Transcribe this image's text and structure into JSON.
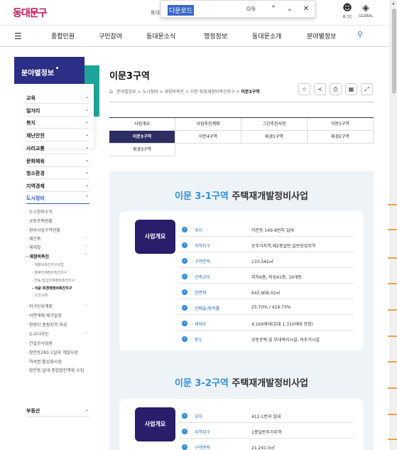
{
  "header": {
    "logo": "동대문구",
    "search_hint": "동대",
    "utils": [
      {
        "icon": "person-icon",
        "glyph": "👤",
        "label": "로그인"
      },
      {
        "icon": "globe-icon",
        "glyph": "🌐",
        "label": "GLOBAL"
      }
    ]
  },
  "find": {
    "query": "다운로드",
    "count": "0/6"
  },
  "gnb": [
    "종합민원",
    "구민참여",
    "동대문소식",
    "행정정보",
    "동대문소개",
    "분야별정보"
  ],
  "lnb": {
    "title": "분야별정보",
    "items": [
      {
        "label": "교육"
      },
      {
        "label": "일자리"
      },
      {
        "label": "복지"
      },
      {
        "label": "재난안전"
      },
      {
        "label": "사리교통"
      },
      {
        "label": "문화체육"
      },
      {
        "label": "청소환경"
      },
      {
        "label": "지역경제"
      },
      {
        "label": "도시정비"
      }
    ],
    "sub": [
      {
        "label": "· 도시정비소식"
      },
      {
        "label": "· 공동주택현황"
      },
      {
        "label": "· 정비사업구역현황"
      },
      {
        "label": "· 재건축"
      },
      {
        "label": "· 재개발"
      },
      {
        "label": "· 재정비촉진"
      }
    ],
    "sub3": [
      "- 재정비촉진지구사업",
      "- 청량리재정비촉진지구",
      "- 전농·답십리재정비촉진지구",
      "- 이문·휘경재정비촉진지구",
      "- 의국사례"
    ],
    "sub_after": [
      {
        "label": "· 지구단위계획"
      },
      {
        "label": "· 석면해체·제거알정"
      },
      {
        "label": "· 청량리 종점지역 육성"
      },
      {
        "label": "· 도시디자인"
      },
      {
        "label": "· 건설공사업원"
      },
      {
        "label": "· 장안동283-1일대 개발사업"
      },
      {
        "label": "· 역세권 활성화사업"
      },
      {
        "label": "· 장안동 일대 종합발전계획 수립"
      }
    ],
    "last": "부동산"
  },
  "page": {
    "title": "이문3구역",
    "breadcrumb": [
      "분야별정보",
      "도시정비",
      "재정비촉진",
      "이문·휘경재정비촉진지구"
    ],
    "breadcrumb_current": "이문3구역",
    "tools": [
      {
        "icon": "star-icon",
        "glyph": "☆"
      },
      {
        "icon": "share-icon",
        "glyph": "⋖"
      },
      {
        "icon": "print-icon",
        "glyph": "⎙"
      },
      {
        "icon": "qr-icon",
        "glyph": "▦"
      },
      {
        "icon": "expand-icon",
        "glyph": "⤢"
      }
    ]
  },
  "tabs": [
    {
      "label": "사업개요"
    },
    {
      "label": "사업추진계획"
    },
    {
      "label": "그간추진사항"
    },
    {
      "label": "이문1구역"
    },
    {
      "label": "이문3구역",
      "selected": true
    },
    {
      "label": "이문4구역"
    },
    {
      "label": "휘경1구역"
    },
    {
      "label": "휘경2구역"
    },
    {
      "label": "휘경3구역"
    }
  ],
  "projects": [
    {
      "title_hl": "이문 3-1구역",
      "title_rest": " 주택재개발정비사업",
      "badge": "사업개요",
      "rows": [
        {
          "label": "위치",
          "value": "이문동 149-8번지 일대"
        },
        {
          "label": "지역지구",
          "value": "순주거지역,제2종일반,일반상업지역"
        },
        {
          "label": "구역면적",
          "value": "133,542㎡"
        },
        {
          "label": "건축규모",
          "value": "지하6층, 지상41층, 19개동"
        },
        {
          "label": "연면적",
          "value": "643,908.02㎡"
        },
        {
          "label": "건폐율/용적률",
          "value": "25.70% / 419.73%"
        },
        {
          "label": "세대수",
          "value": "4,169세대(임대 1,310세대 포함)"
        },
        {
          "label": "용도",
          "value": "공동주택 및 부대복리시설, 비주거시설"
        }
      ]
    },
    {
      "title_hl": "이문 3-2구역",
      "title_rest": " 주택재개발정비사업",
      "badge": "사업개요",
      "rows": [
        {
          "label": "위치",
          "value": "412-1번지 일대"
        },
        {
          "label": "지역지구",
          "value": "1종일반주거지역"
        },
        {
          "label": "구역면적",
          "value": "21,241.0㎡"
        }
      ]
    }
  ]
}
